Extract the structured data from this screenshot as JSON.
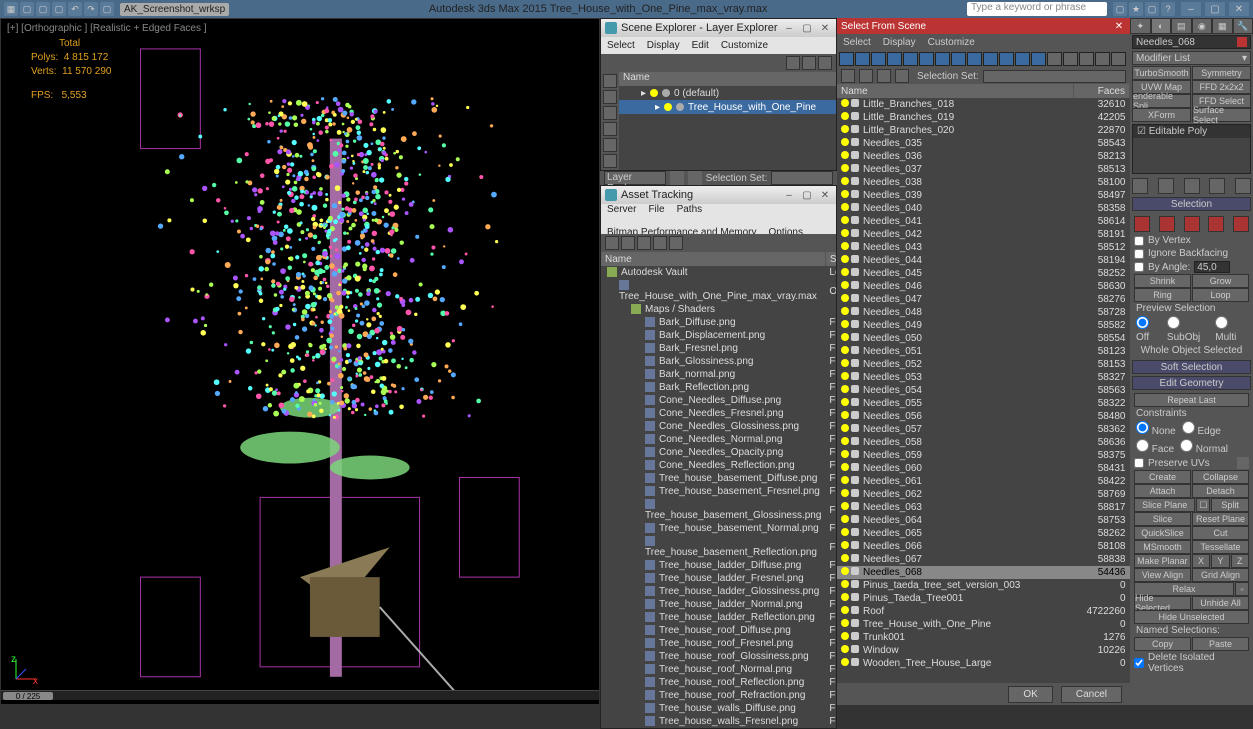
{
  "titlebar": {
    "workspace": "AK_Screenshot_wrksp",
    "title": "Autodesk 3ds Max 2015   Tree_House_with_One_Pine_max_vray.max",
    "search_placeholder": "Type a keyword or phrase"
  },
  "viewport": {
    "label": "[+] [Orthographic ] [Realistic + Edged Faces ]",
    "stats": {
      "total_label": "Total",
      "polys_label": "Polys:",
      "polys_value": "4 815 172",
      "verts_label": "Verts:",
      "verts_value": "11 570 290",
      "fps_label": "FPS:",
      "fps_value": "5,553"
    },
    "slider": "0 / 225"
  },
  "scene_explorer": {
    "title": "Scene Explorer - Layer Explorer",
    "menu": [
      "Select",
      "Display",
      "Edit",
      "Customize"
    ],
    "header": "Name",
    "rows": [
      {
        "label": "0 (default)",
        "indent": 14,
        "sel": false
      },
      {
        "label": "Tree_House_with_One_Pine",
        "indent": 28,
        "sel": true
      }
    ],
    "drop_label": "Layer Explorer",
    "selset_label": "Selection Set:"
  },
  "asset_tracking": {
    "title": "Asset Tracking",
    "menu": [
      "Server",
      "File",
      "Paths",
      "Bitmap Performance and Memory",
      "Options"
    ],
    "cols": [
      "Name",
      "Status"
    ],
    "root": {
      "label": "Autodesk Vault",
      "status": "Logged"
    },
    "file": {
      "label": "Tree_House_with_One_Pine_max_vray.max",
      "status": "Ok"
    },
    "group": {
      "label": "Maps / Shaders",
      "status": ""
    },
    "assets": [
      [
        "Bark_Diffuse.png",
        "Found"
      ],
      [
        "Bark_Displacement.png",
        "Found"
      ],
      [
        "Bark_Fresnel.png",
        "Found"
      ],
      [
        "Bark_Glossiness.png",
        "Found"
      ],
      [
        "Bark_normal.png",
        "Found"
      ],
      [
        "Bark_Reflection.png",
        "Found"
      ],
      [
        "Cone_Needles_Diffuse.png",
        "Found"
      ],
      [
        "Cone_Needles_Fresnel.png",
        "Found"
      ],
      [
        "Cone_Needles_Glossiness.png",
        "Found"
      ],
      [
        "Cone_Needles_Normal.png",
        "Found"
      ],
      [
        "Cone_Needles_Opacity.png",
        "Found"
      ],
      [
        "Cone_Needles_Reflection.png",
        "Found"
      ],
      [
        "Tree_house_basement_Diffuse.png",
        "Found"
      ],
      [
        "Tree_house_basement_Fresnel.png",
        "Found"
      ],
      [
        "Tree_house_basement_Glossiness.png",
        "Found"
      ],
      [
        "Tree_house_basement_Normal.png",
        "Found"
      ],
      [
        "Tree_house_basement_Reflection.png",
        "Found"
      ],
      [
        "Tree_house_ladder_Diffuse.png",
        "Found"
      ],
      [
        "Tree_house_ladder_Fresnel.png",
        "Found"
      ],
      [
        "Tree_house_ladder_Glossiness.png",
        "Found"
      ],
      [
        "Tree_house_ladder_Normal.png",
        "Found"
      ],
      [
        "Tree_house_ladder_Reflection.png",
        "Found"
      ],
      [
        "Tree_house_roof_Diffuse.png",
        "Found"
      ],
      [
        "Tree_house_roof_Fresnel.png",
        "Found"
      ],
      [
        "Tree_house_roof_Glossiness.png",
        "Found"
      ],
      [
        "Tree_house_roof_Normal.png",
        "Found"
      ],
      [
        "Tree_house_roof_Reflection.png",
        "Found"
      ],
      [
        "Tree_house_roof_Refraction.png",
        "Found"
      ],
      [
        "Tree_house_walls_Diffuse.png",
        "Found"
      ],
      [
        "Tree_house_walls_Fresnel.png",
        "Found"
      ]
    ]
  },
  "select_scene": {
    "title": "Select From Scene",
    "menu": [
      "Select",
      "Display",
      "Customize"
    ],
    "selset_label": "Selection Set:",
    "cols": [
      "Name",
      "Faces"
    ],
    "rows": [
      {
        "name": "Little_Branches_018",
        "faces": "32610",
        "sel": false
      },
      {
        "name": "Little_Branches_019",
        "faces": "42205",
        "sel": false
      },
      {
        "name": "Little_Branches_020",
        "faces": "22870",
        "sel": false
      },
      {
        "name": "Needles_035",
        "faces": "58543",
        "sel": false
      },
      {
        "name": "Needles_036",
        "faces": "58213",
        "sel": false
      },
      {
        "name": "Needles_037",
        "faces": "58513",
        "sel": false
      },
      {
        "name": "Needles_038",
        "faces": "58100",
        "sel": false
      },
      {
        "name": "Needles_039",
        "faces": "58497",
        "sel": false
      },
      {
        "name": "Needles_040",
        "faces": "58358",
        "sel": false
      },
      {
        "name": "Needles_041",
        "faces": "58614",
        "sel": false
      },
      {
        "name": "Needles_042",
        "faces": "58191",
        "sel": false
      },
      {
        "name": "Needles_043",
        "faces": "58512",
        "sel": false
      },
      {
        "name": "Needles_044",
        "faces": "58194",
        "sel": false
      },
      {
        "name": "Needles_045",
        "faces": "58252",
        "sel": false
      },
      {
        "name": "Needles_046",
        "faces": "58630",
        "sel": false
      },
      {
        "name": "Needles_047",
        "faces": "58276",
        "sel": false
      },
      {
        "name": "Needles_048",
        "faces": "58728",
        "sel": false
      },
      {
        "name": "Needles_049",
        "faces": "58582",
        "sel": false
      },
      {
        "name": "Needles_050",
        "faces": "58554",
        "sel": false
      },
      {
        "name": "Needles_051",
        "faces": "58123",
        "sel": false
      },
      {
        "name": "Needles_052",
        "faces": "58153",
        "sel": false
      },
      {
        "name": "Needles_053",
        "faces": "58327",
        "sel": false
      },
      {
        "name": "Needles_054",
        "faces": "58563",
        "sel": false
      },
      {
        "name": "Needles_055",
        "faces": "58322",
        "sel": false
      },
      {
        "name": "Needles_056",
        "faces": "58480",
        "sel": false
      },
      {
        "name": "Needles_057",
        "faces": "58362",
        "sel": false
      },
      {
        "name": "Needles_058",
        "faces": "58636",
        "sel": false
      },
      {
        "name": "Needles_059",
        "faces": "58375",
        "sel": false
      },
      {
        "name": "Needles_060",
        "faces": "58431",
        "sel": false
      },
      {
        "name": "Needles_061",
        "faces": "58422",
        "sel": false
      },
      {
        "name": "Needles_062",
        "faces": "58769",
        "sel": false
      },
      {
        "name": "Needles_063",
        "faces": "58817",
        "sel": false
      },
      {
        "name": "Needles_064",
        "faces": "58753",
        "sel": false
      },
      {
        "name": "Needles_065",
        "faces": "58262",
        "sel": false
      },
      {
        "name": "Needles_066",
        "faces": "58108",
        "sel": false
      },
      {
        "name": "Needles_067",
        "faces": "58838",
        "sel": false
      },
      {
        "name": "Needles_068",
        "faces": "54436",
        "sel": true
      },
      {
        "name": "Pinus_taeda_tree_set_version_003",
        "faces": "0",
        "sel": false
      },
      {
        "name": "Pinus_Taeda_Tree001",
        "faces": "0",
        "sel": false
      },
      {
        "name": "Roof",
        "faces": "4722260",
        "sel": false
      },
      {
        "name": "Tree_House_with_One_Pine",
        "faces": "0",
        "sel": false
      },
      {
        "name": "Trunk001",
        "faces": "1276",
        "sel": false
      },
      {
        "name": "Window",
        "faces": "10226",
        "sel": false
      },
      {
        "name": "Wooden_Tree_House_Large",
        "faces": "0",
        "sel": false
      }
    ],
    "ok": "OK",
    "cancel": "Cancel"
  },
  "command": {
    "object_name": "Needles_068",
    "modifier_list": "Modifier List",
    "mods": [
      [
        "TurboSmooth",
        "Symmetry"
      ],
      [
        "UVW Map",
        "FFD 2x2x2"
      ],
      [
        "enderable Spli",
        "FFD Select"
      ],
      [
        "XForm",
        "Surface Select"
      ]
    ],
    "stack_item": "Editable Poly",
    "selection": {
      "title": "Selection",
      "by_vertex": "By Vertex",
      "ignore_back": "Ignore Backfacing",
      "by_angle": "By Angle:",
      "angle_val": "45,0",
      "shrink": "Shrink",
      "grow": "Grow",
      "ring": "Ring",
      "loop": "Loop",
      "preview_label": "Preview Selection",
      "off": "Off",
      "subobj": "SubObj",
      "multi": "Multi",
      "whole": "Whole Object Selected"
    },
    "soft_sel": "Soft Selection",
    "edit_geom": {
      "title": "Edit Geometry",
      "repeat": "Repeat Last",
      "constraints": "Constraints",
      "none": "None",
      "edge": "Edge",
      "face": "Face",
      "normal": "Normal",
      "preserve_uv": "Preserve UVs",
      "create": "Create",
      "collapse": "Collapse",
      "attach": "Attach",
      "detach": "Detach",
      "slice_plane": "Slice Plane",
      "split": "Split",
      "slice": "Slice",
      "reset_plane": "Reset Plane",
      "quickslice": "QuickSlice",
      "cut": "Cut",
      "msmooth": "MSmooth",
      "tessellate": "Tessellate",
      "make_planar": "Make Planar",
      "x": "X",
      "y": "Y",
      "z": "Z",
      "view_align": "View Align",
      "grid_align": "Grid Align",
      "relax": "Relax",
      "hide_sel": "Hide Selected",
      "unhide_all": "Unhide All",
      "hide_unsel": "Hide Unselected",
      "named_sel": "Named Selections:",
      "copy": "Copy",
      "paste": "Paste",
      "delete_iso": "Delete Isolated Vertices"
    }
  }
}
